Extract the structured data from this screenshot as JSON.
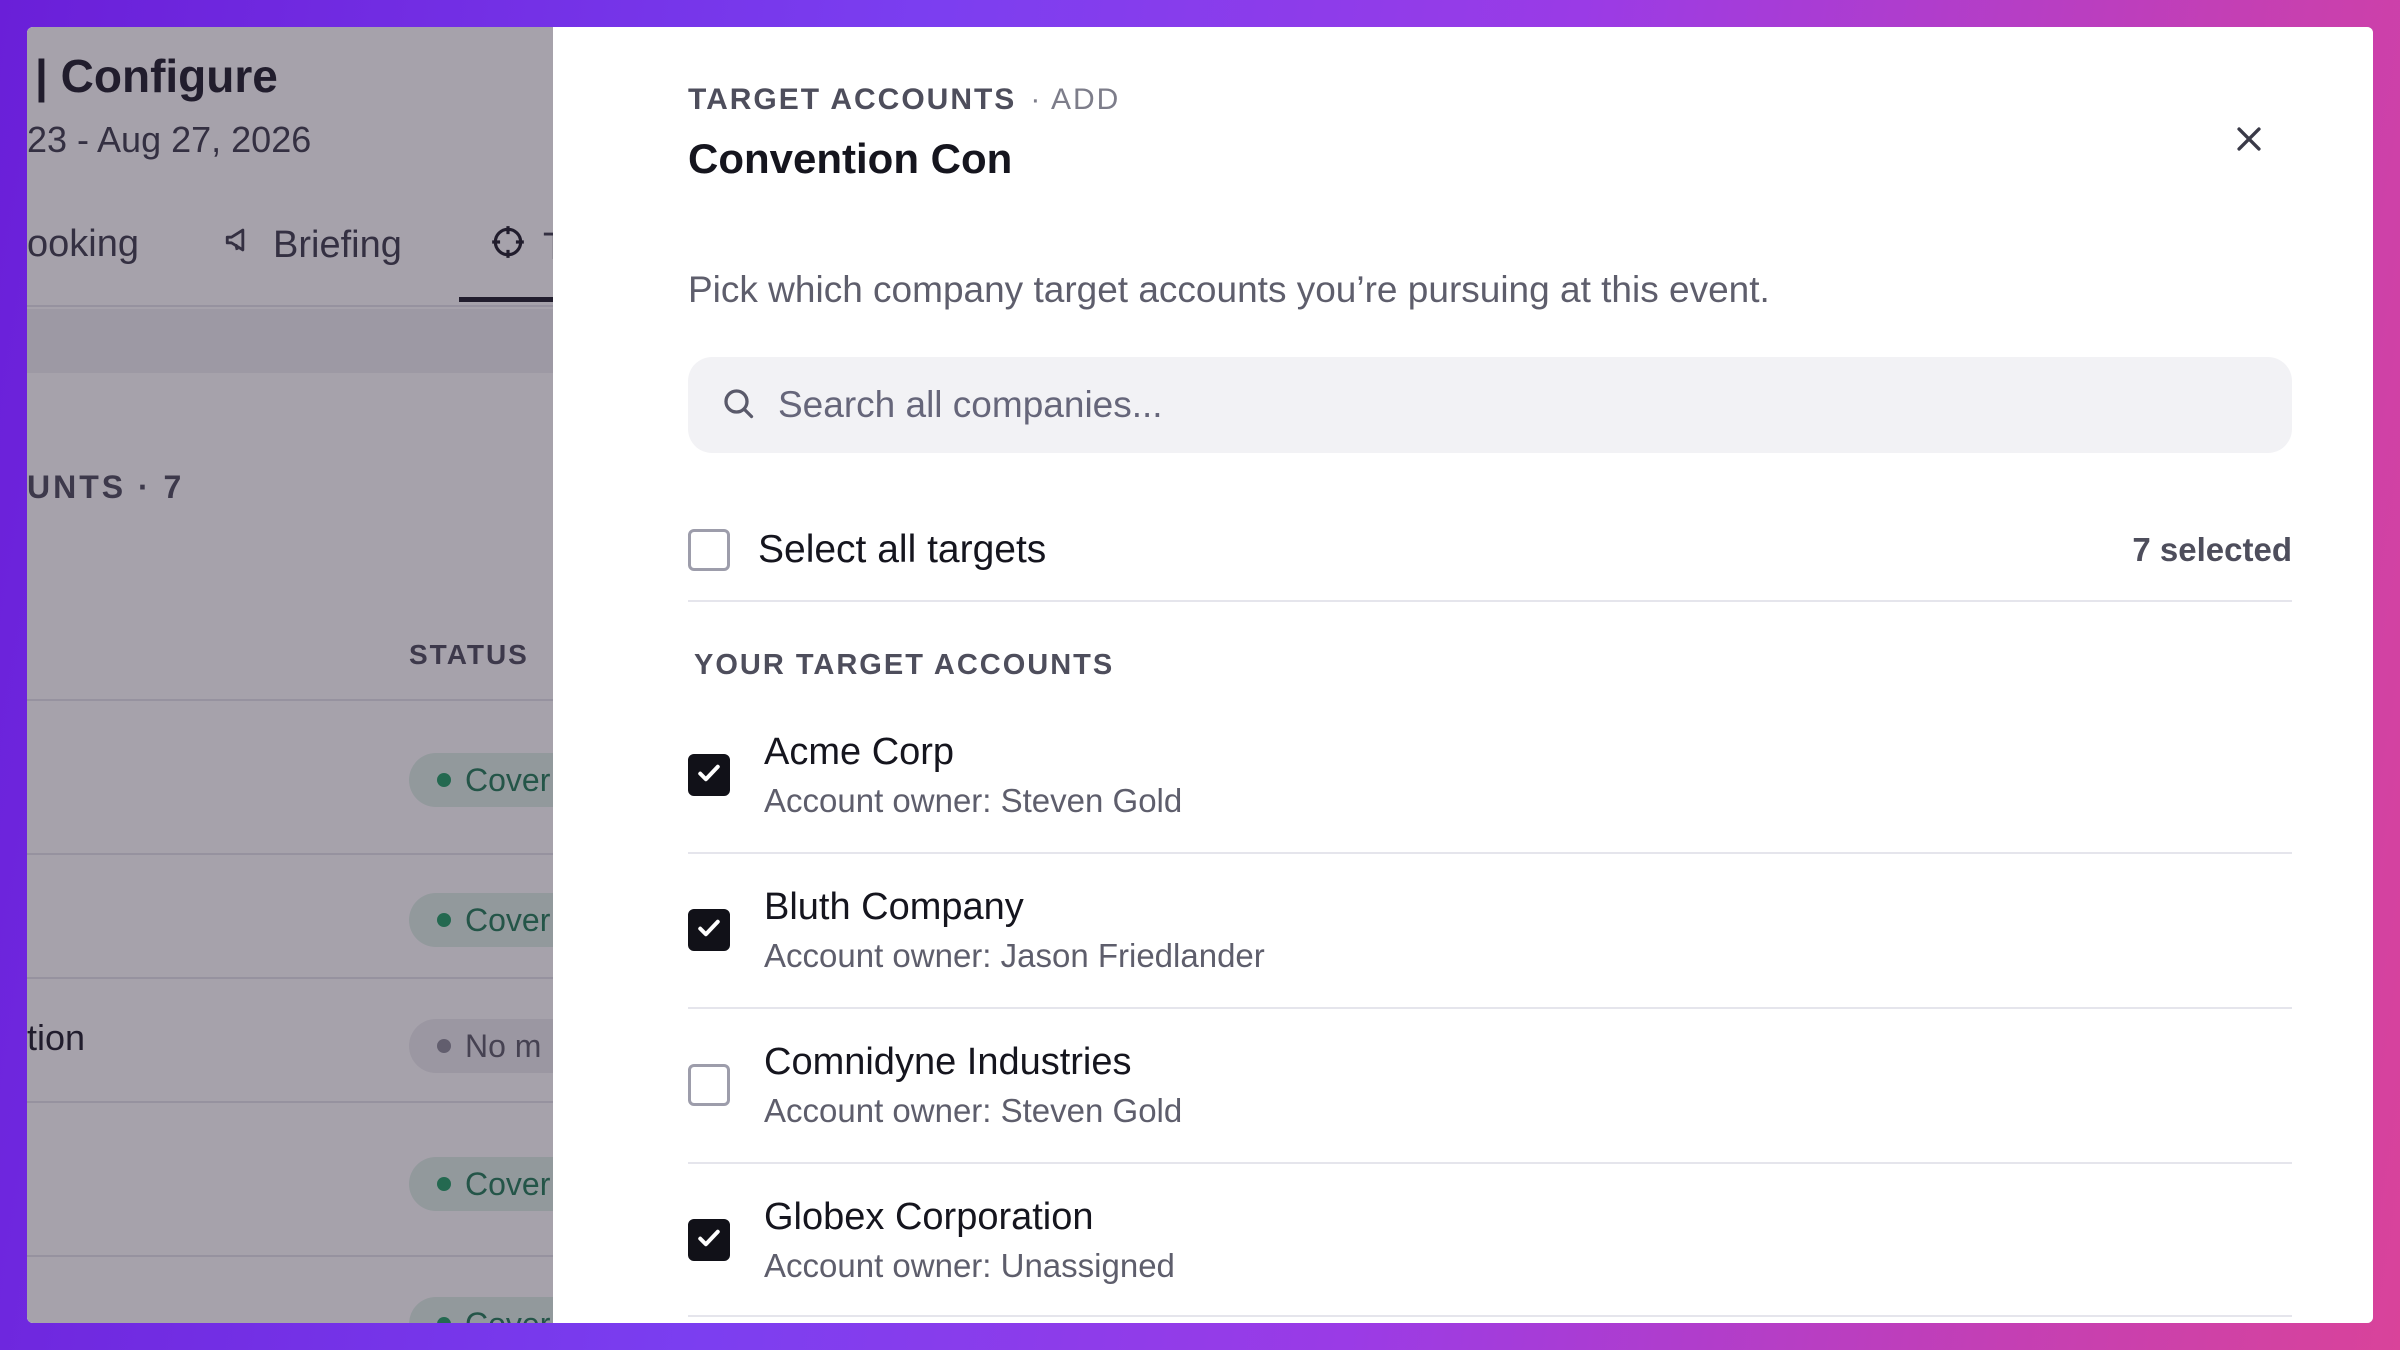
{
  "background_page": {
    "title": "| Configure",
    "date_range": "23 - Aug 27, 2026",
    "tabs": [
      {
        "label": "ooking",
        "icon": ""
      },
      {
        "label": "Briefing",
        "icon": "megaphone-icon"
      },
      {
        "label": "T",
        "icon": "crosshair-icon"
      }
    ],
    "section_label": "UNTS · 7",
    "status_header": "STATUS",
    "partial_row_text": "tion",
    "status_pills": [
      {
        "label": "Cover",
        "tone": "green"
      },
      {
        "label": "Cover",
        "tone": "green"
      },
      {
        "label": "No m",
        "tone": "gray"
      },
      {
        "label": "Cover",
        "tone": "green"
      },
      {
        "label": "Cover",
        "tone": "green"
      }
    ]
  },
  "drawer": {
    "eyebrow": "TARGET ACCOUNTS",
    "eyebrow_action": "· ADD",
    "title": "Convention Con",
    "description": "Pick which company target accounts you’re pursuing at this event.",
    "search": {
      "placeholder": "Search all companies...",
      "value": ""
    },
    "select_all": {
      "label": "Select all targets",
      "checked": false,
      "count_text": "7 selected"
    },
    "group_heading": "YOUR TARGET ACCOUNTS",
    "accounts": [
      {
        "name": "Acme Corp",
        "owner": "Account owner: Steven Gold",
        "checked": true
      },
      {
        "name": "Bluth Company",
        "owner": "Account owner: Jason Friedlander",
        "checked": true
      },
      {
        "name": "Comnidyne Industries",
        "owner": "Account owner: Steven Gold",
        "checked": false
      },
      {
        "name": "Globex Corporation",
        "owner": "Account owner: Unassigned",
        "checked": true
      }
    ]
  },
  "colors": {
    "accent_dark": "#111118",
    "status_green": "#1f9d62",
    "overlay": "#2a2236"
  }
}
